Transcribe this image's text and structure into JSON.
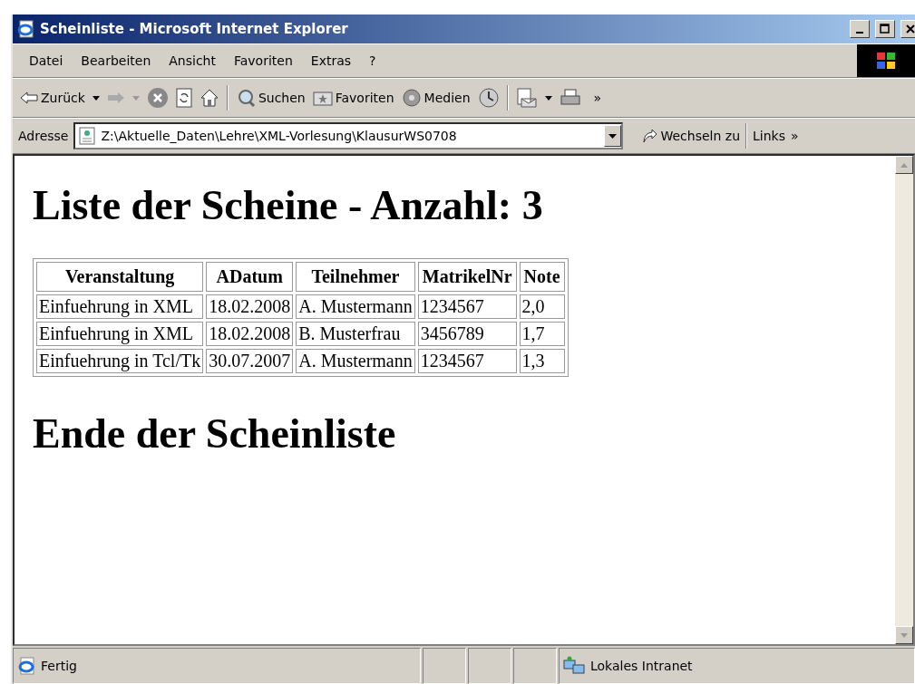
{
  "window": {
    "title": "Scheinliste - Microsoft Internet Explorer"
  },
  "menu": [
    "Datei",
    "Bearbeiten",
    "Ansicht",
    "Favoriten",
    "Extras",
    "?"
  ],
  "toolbar": {
    "back": "Zurück",
    "search": "Suchen",
    "favorites": "Favoriten",
    "media": "Medien",
    "more": "»"
  },
  "address": {
    "label": "Adresse",
    "value": "Z:\\Aktuelle_Daten\\Lehre\\XML-Vorlesung\\KlausurWS0708",
    "go": "Wechseln zu",
    "links": "Links",
    "more": "»"
  },
  "page": {
    "heading": "Liste der Scheine - Anzahl: 3",
    "table": {
      "columns": [
        "Veranstaltung",
        "ADatum",
        "Teilnehmer",
        "MatrikelNr",
        "Note"
      ],
      "rows": [
        [
          "Einfuehrung in XML",
          "18.02.2008",
          "A. Mustermann",
          "1234567",
          "2,0"
        ],
        [
          "Einfuehrung in XML",
          "18.02.2008",
          "B. Musterfrau",
          "3456789",
          "1,7"
        ],
        [
          "Einfuehrung in Tcl/Tk",
          "30.07.2007",
          "A. Mustermann",
          "1234567",
          "1,3"
        ]
      ]
    },
    "footer_heading": "Ende der Scheinliste"
  },
  "status_bar": {
    "text": "Fertig",
    "zone": "Lokales Intranet"
  }
}
